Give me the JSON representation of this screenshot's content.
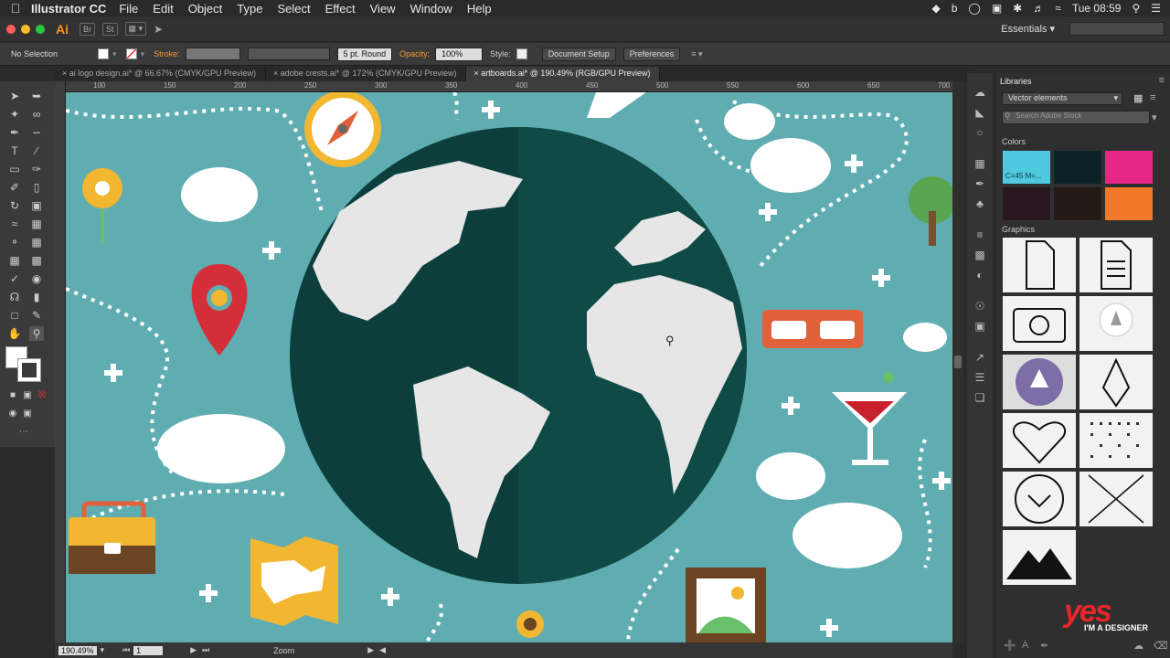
{
  "menubar": {
    "app_name": "Illustrator CC",
    "items": [
      "File",
      "Edit",
      "Object",
      "Type",
      "Select",
      "Effect",
      "View",
      "Window",
      "Help"
    ],
    "clock": "Tue 08:59"
  },
  "appbar": {
    "logo": "Ai",
    "bridge": "Br",
    "stock": "St",
    "workspace": "Essentials"
  },
  "control": {
    "selection": "No Selection",
    "stroke_label": "Stroke:",
    "brush": "5 pt. Round",
    "opacity_label": "Opacity:",
    "opacity_value": "100%",
    "style_label": "Style:",
    "document_setup": "Document Setup",
    "preferences": "Preferences"
  },
  "tabs": [
    {
      "label": "ai logo design.ai* @ 66.67% (CMYK/GPU Preview)",
      "active": false
    },
    {
      "label": "adobe crests.ai* @ 172% (CMYK/GPU Preview)",
      "active": false
    },
    {
      "label": "artboards.ai* @ 190.49% (RGB/GPU Preview)",
      "active": true
    }
  ],
  "ruler": {
    "ticks": [
      "100",
      "150",
      "200",
      "250",
      "300",
      "350",
      "400",
      "450",
      "500",
      "550",
      "600",
      "650",
      "700"
    ]
  },
  "status": {
    "zoom": "190.49%",
    "page": "1",
    "tool": "Zoom"
  },
  "libraries": {
    "title": "Libraries",
    "library_name": "Vector elements",
    "search_placeholder": "Search Adobe Stock",
    "colors_label": "Colors",
    "color_hint": "C=45 M=...",
    "colors": [
      "#4fc8e0",
      "#0c2428",
      "#e5278a",
      "#2a1820",
      "#241b16",
      "#f07a2a"
    ],
    "graphics_label": "Graphics"
  },
  "watermark": {
    "brand": "yes",
    "tagline": "I'M A DESIGNER"
  },
  "colors": {
    "canvas": "#5fadb1",
    "globe_dark": "#0c3f3c",
    "land": "#e6e6e6"
  }
}
